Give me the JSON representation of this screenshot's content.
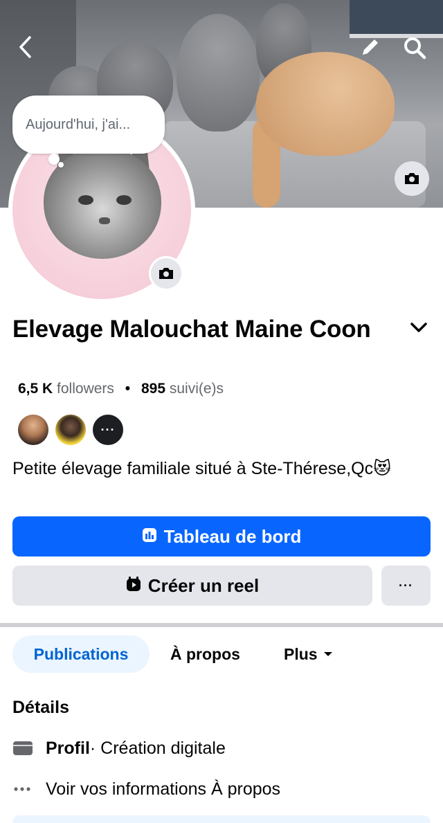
{
  "header": {
    "back_icon": "chevron-left-icon",
    "edit_icon": "pencil-icon",
    "search_icon": "search-icon"
  },
  "note": {
    "text": "Aujourd'hui, j'ai..."
  },
  "profile": {
    "name": "Elevage Malouchat Maine Coon",
    "followers_count": "6,5 K",
    "followers_label": "followers",
    "following_count": "895",
    "following_label": "suivi(e)s",
    "bio": "Petite élevage familiale situé à Ste-Thérese,Qc",
    "bio_emoji": "😻"
  },
  "friends": {
    "more_label": "···"
  },
  "buttons": {
    "dashboard_label": "Tableau de bord",
    "create_reel_label": "Créer un reel",
    "more_label": "···"
  },
  "tabs": [
    {
      "label": "Publications",
      "active": true
    },
    {
      "label": "À propos",
      "active": false
    },
    {
      "label": "Plus",
      "active": false
    }
  ],
  "details": {
    "title": "Détails",
    "items": [
      {
        "bold": "Profil",
        "text": " · Création digitale",
        "icon": "clapperboard-icon"
      },
      {
        "bold": "",
        "text": "Voir vos informations À propos",
        "icon": "more-dots-icon"
      }
    ]
  },
  "colors": {
    "primary": "#0866ff",
    "secondary_bg": "#e4e6eb",
    "active_tab_bg": "#ebf5ff",
    "active_tab_text": "#0064d1"
  }
}
